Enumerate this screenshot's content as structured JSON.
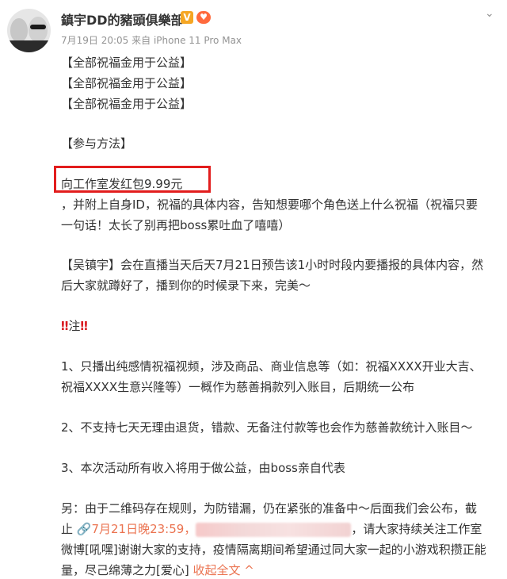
{
  "post": {
    "username": "鎮宇DD的豬頭俱樂部",
    "verified_badge": "V",
    "meta_time": "7月19日 20:05",
    "meta_source": "来自 iPhone 11 Pro Max",
    "more_icon": "chevron-down-icon",
    "lines": {
      "l1": "【全部祝福金用于公益】",
      "l2": "【全部祝福金用于公益】",
      "l3": "【全部祝福金用于公益】",
      "l4": "【参与方法】",
      "l5": "向工作室发红包9.99元",
      "l6": "，并附上自身ID，祝福的具体内容，告知想要哪个角色送上什么祝福（祝福只要",
      "l7": "一句话！太长了别再把boss累吐血了嘻嘻）",
      "l8": "【吴镇宇】会在直播当天后天7月21日预告该1小时时段内要播报的具体内容，然",
      "l9": "后大家就蹲好了，播到你的时候录下来，完美～",
      "l10_mark": "‼",
      "l10_text": "注",
      "l11": "1、只播出纯感情祝福视频，涉及商品、商业信息等（如：祝福XXXX开业大吉、",
      "l12": "祝福XXXX生意兴隆等）一概作为慈善捐款列入账目，后期统一公布",
      "l13": "2、不支持七天无理由退货，错款、无备注付款等也会作为慈善款统计入账目～",
      "l14": "3、本次活动所有收入将用于做公益，由boss亲自代表",
      "l15": "另：由于二维码存在规则，为防错漏，仍在紧张的准备中～后面我们会公布，截",
      "l16_a": "止 ",
      "l16_link": "7月21日晚23:59，",
      "l16_b": "，请大家持续关注工作室",
      "l17": "微博[吼嘿]谢谢大家的支持，疫情隔离期间希望通过同大家一起的小游戏积攒正能",
      "l18_a": "量，尽己绵薄之力[爱心] ",
      "l18_collapse": "收起全文 ^"
    }
  }
}
